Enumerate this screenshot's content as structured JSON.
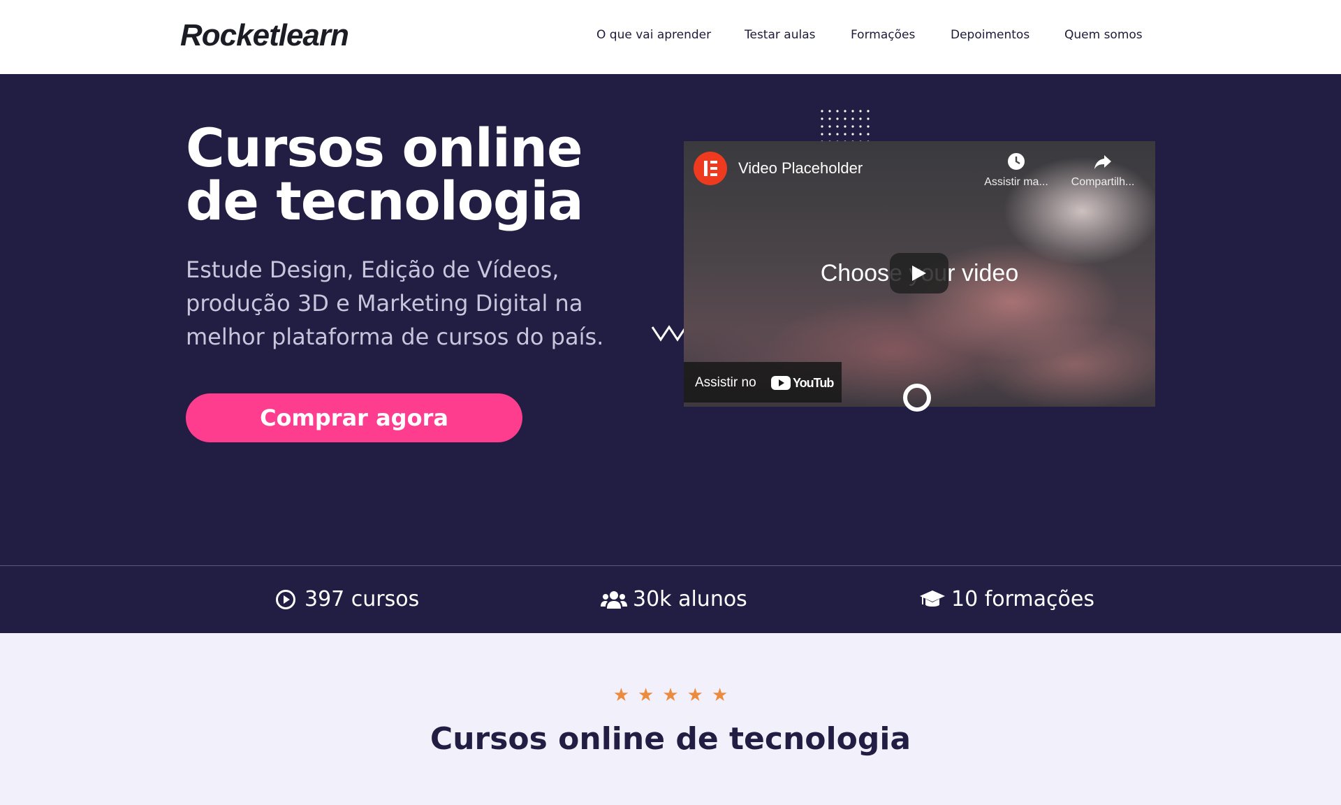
{
  "header": {
    "logo": "Rocketlearn",
    "nav": [
      "O que vai aprender",
      "Testar aulas",
      "Formações",
      "Depoimentos",
      "Quem somos"
    ]
  },
  "hero": {
    "title": "Cursos online de tecnologia",
    "subtitle": "Estude Design, Edição de Vídeos, produção 3D e Marketing Digital na melhor plataforma de cursos do país.",
    "cta": "Comprar agora"
  },
  "video": {
    "title": "Video Placeholder",
    "watch_later": "Assistir ma...",
    "share": "Compartilh...",
    "placeholder_text": "Choose your video",
    "watch_on": "Assistir no",
    "youtube": "YouTube"
  },
  "stats": [
    {
      "icon": "play-circle-icon",
      "label": "397 cursos"
    },
    {
      "icon": "users-icon",
      "label": "30k alunos"
    },
    {
      "icon": "graduation-cap-icon",
      "label": "10 formações"
    }
  ],
  "rating": {
    "stars": 5
  },
  "section": {
    "title": "Cursos online de tecnologia"
  },
  "colors": {
    "hero_bg": "#221d42",
    "cta": "#ff3d8f",
    "star": "#ec8a3e",
    "page_bg": "#f2f1fb"
  }
}
